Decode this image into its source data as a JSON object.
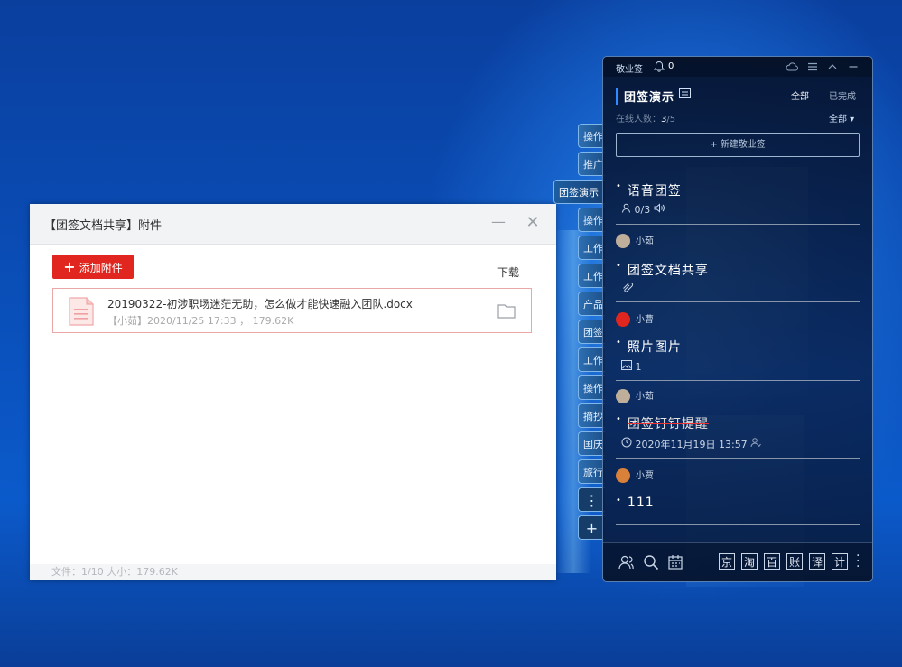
{
  "desktop": {
    "side_tabs": [
      "操作",
      "推广",
      "团签演示",
      "操作",
      "工作",
      "工作",
      "产品",
      "团签",
      "工作",
      "操作",
      "摘抄",
      "国庆",
      "旅行",
      "⋮",
      "+"
    ]
  },
  "dialog": {
    "title": "【团签文档共享】附件",
    "minimize_glyph": "—",
    "close_glyph": "✕",
    "add_button": "添加附件",
    "download_label": "下载",
    "file": {
      "name": "20190322-初涉职场迷茫无助，怎么做才能快速融入团队.docx",
      "meta": "【小茹】2020/11/25 17:33 ， 179.62K"
    },
    "footer": "文件：1/10    大小：179.62K"
  },
  "panel": {
    "app_name": "敬业签",
    "notification_count": "0",
    "group_name": "团签演示",
    "filter_all": "全部",
    "filter_done": "已完成",
    "online_label": "在线人数：",
    "online_current": "3",
    "online_total": "/5",
    "member_filter": "全部 ▾",
    "new_note": "+ 新建敬业签",
    "notes": [
      {
        "author": "",
        "title": "语音团签",
        "sub": "0/3"
      },
      {
        "author": "小茹",
        "title": "团签文档共享",
        "sub": ""
      },
      {
        "author": "小曹",
        "title": "照片图片",
        "sub": "1"
      },
      {
        "author": "小茹",
        "title": "团签钉钉提醒",
        "sub": "2020年11月19日  13:57"
      },
      {
        "author": "小贾",
        "title": "111",
        "sub": ""
      }
    ],
    "bottom_shortcuts": [
      "京",
      "淘",
      "百",
      "账",
      "译",
      "计"
    ]
  },
  "colors": {
    "accent_red": "#e0261e",
    "panel_accent": "#2d8cff"
  }
}
